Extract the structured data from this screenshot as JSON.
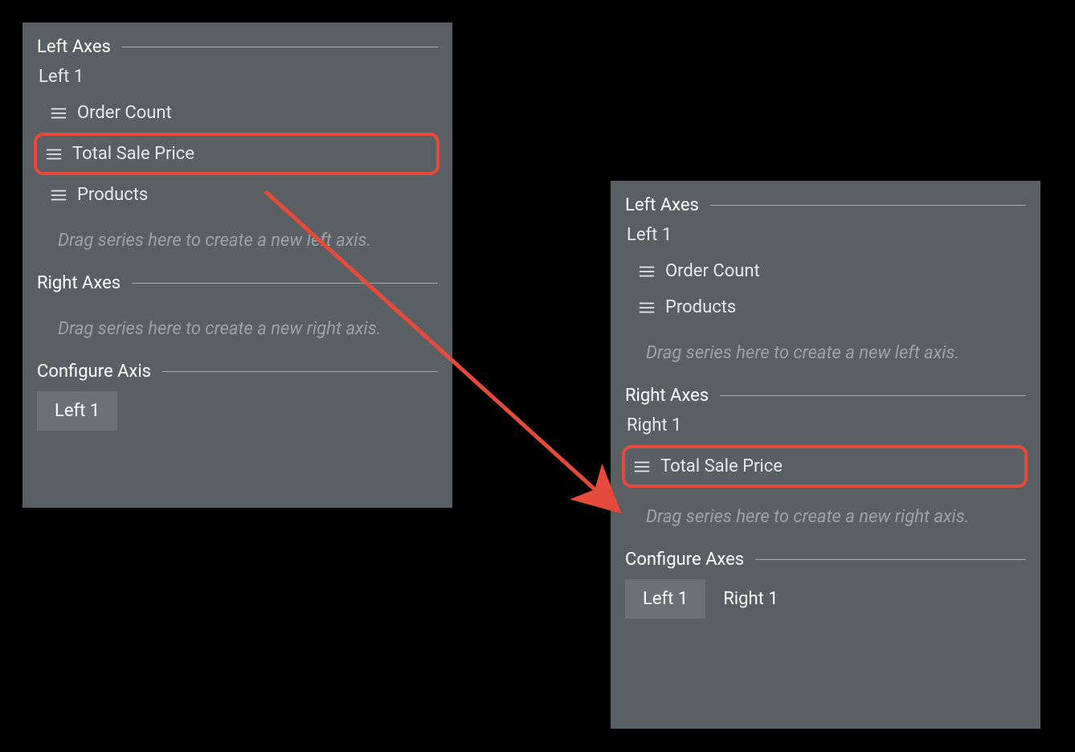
{
  "annotation_color": "#e54b3a",
  "left_panel": {
    "left_axes": {
      "title": "Left Axes",
      "axis_label": "Left 1",
      "items": [
        {
          "label": "Order Count"
        },
        {
          "label": "Total Sale Price",
          "highlight": true
        },
        {
          "label": "Products"
        }
      ],
      "drop_hint": "Drag series here to create a new left axis."
    },
    "right_axes": {
      "title": "Right Axes",
      "drop_hint": "Drag series here to create a new right axis."
    },
    "configure": {
      "title": "Configure Axis",
      "tabs": [
        {
          "label": "Left 1",
          "active": true
        }
      ]
    }
  },
  "right_panel": {
    "left_axes": {
      "title": "Left Axes",
      "axis_label": "Left 1",
      "items": [
        {
          "label": "Order Count"
        },
        {
          "label": "Products"
        }
      ],
      "drop_hint": "Drag series here to create a new left axis."
    },
    "right_axes": {
      "title": "Right Axes",
      "axis_label": "Right 1",
      "items": [
        {
          "label": "Total Sale Price",
          "highlight": true
        }
      ],
      "drop_hint": "Drag series here to create a new right axis."
    },
    "configure": {
      "title": "Configure Axes",
      "tabs": [
        {
          "label": "Left 1",
          "active": true
        },
        {
          "label": "Right 1",
          "active": false
        }
      ]
    }
  }
}
